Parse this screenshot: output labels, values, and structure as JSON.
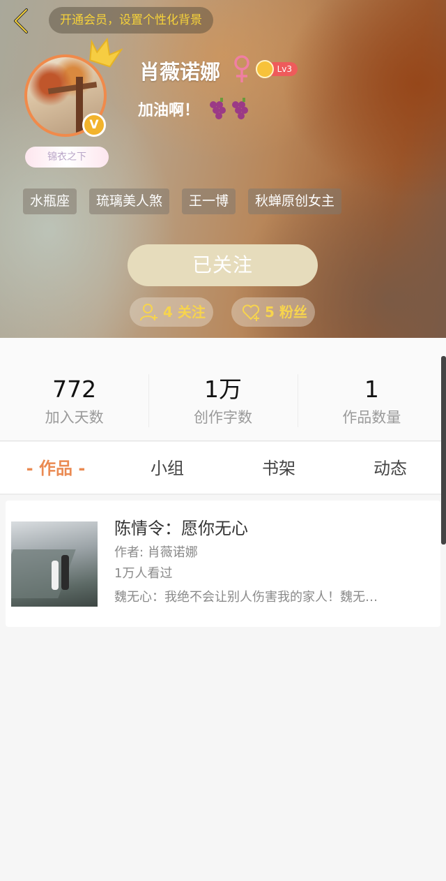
{
  "header": {
    "vip_banner": "开通会员，设置个性化背景",
    "nameplate": "锦衣之下",
    "username": "肖薇诺娜",
    "level": "Lv3",
    "v_badge": "V",
    "motto": "加油啊！",
    "tags": [
      "水瓶座",
      "琉璃美人煞",
      "王一博",
      "秋蝉原创女主"
    ],
    "follow_button": "已关注",
    "following_count": "4 关注",
    "fans_count": "5 粉丝",
    "colors": {
      "accent": "#f08a4b",
      "gold": "#f7d44d",
      "follow_bg": "#e6dcbc"
    }
  },
  "counts": [
    {
      "value": "772",
      "label": "加入天数"
    },
    {
      "value": "1万",
      "label": "创作字数"
    },
    {
      "value": "1",
      "label": "作品数量"
    }
  ],
  "tabs": [
    "- 作品 -",
    "小组",
    "书架",
    "动态"
  ],
  "work": {
    "title": "陈情令：愿你无心",
    "author": "作者: 肖薇诺娜",
    "views": "1万人看过",
    "description": "魏无心：我绝不会让别人伤害我的家人！魏无…"
  }
}
